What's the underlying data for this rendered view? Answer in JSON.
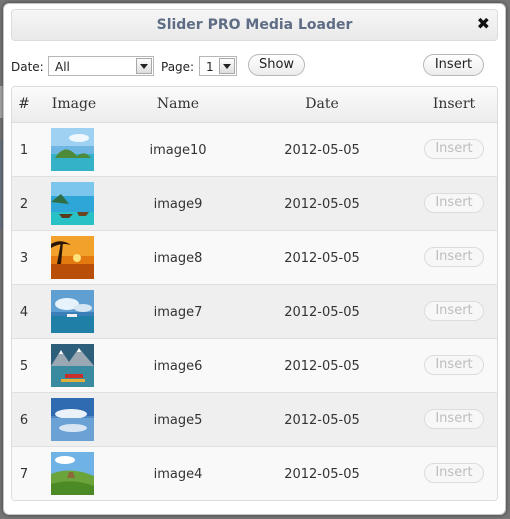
{
  "dialog": {
    "title": "Slider PRO Media Loader",
    "close_glyph": "✖"
  },
  "toolbar": {
    "date_label": "Date:",
    "date_value": "All",
    "page_label": "Page:",
    "page_value": "1",
    "show_label": "Show",
    "insert_label": "Insert"
  },
  "table": {
    "headers": [
      "#",
      "Image",
      "Name",
      "Date",
      "Insert"
    ],
    "rows": [
      {
        "num": "1",
        "name": "image10",
        "date": "2012-05-05",
        "insert": "Insert",
        "thumb": "tropical-island"
      },
      {
        "num": "2",
        "name": "image9",
        "date": "2012-05-05",
        "insert": "Insert",
        "thumb": "beach-boats"
      },
      {
        "num": "3",
        "name": "image8",
        "date": "2012-05-05",
        "insert": "Insert",
        "thumb": "sunset-palm"
      },
      {
        "num": "4",
        "name": "image7",
        "date": "2012-05-05",
        "insert": "Insert",
        "thumb": "sea-clouds"
      },
      {
        "num": "5",
        "name": "image6",
        "date": "2012-05-05",
        "insert": "Insert",
        "thumb": "mountain-lake"
      },
      {
        "num": "6",
        "name": "image5",
        "date": "2012-05-05",
        "insert": "Insert",
        "thumb": "sky-reflection"
      },
      {
        "num": "7",
        "name": "image4",
        "date": "2012-05-05",
        "insert": "Insert",
        "thumb": "green-hills"
      }
    ]
  },
  "colors": {
    "title_text": "#5e6d85",
    "row_odd": "#f9f9f9",
    "row_even": "#efefef",
    "disabled_text": "#bdbdbd"
  }
}
